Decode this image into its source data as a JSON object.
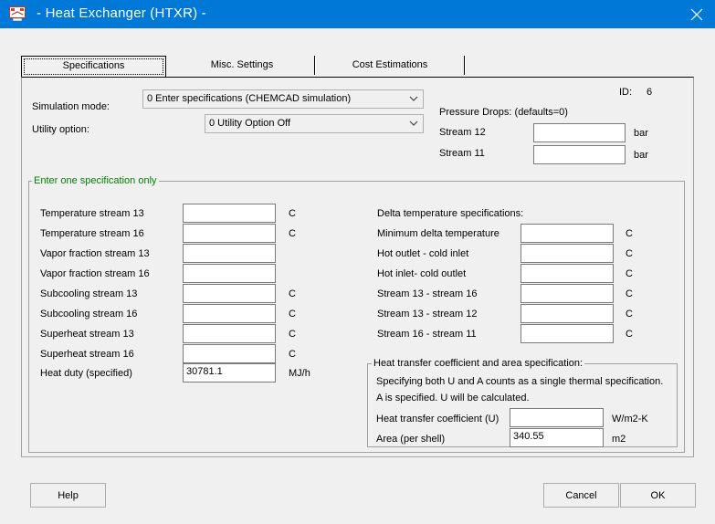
{
  "window": {
    "title": "- Heat Exchanger (HTXR) -"
  },
  "tabs": [
    {
      "label": "Specifications"
    },
    {
      "label": "Misc. Settings"
    },
    {
      "label": "Cost Estimations"
    }
  ],
  "header": {
    "simulation_mode_label": "Simulation mode:",
    "simulation_mode_value": "0 Enter specifications (CHEMCAD simulation)",
    "utility_option_label": "Utility option:",
    "utility_option_value": "0 Utility Option Off",
    "id_label": "ID:",
    "id_value": "6"
  },
  "pressure_drops": {
    "title": "Pressure Drops:  (defaults=0)",
    "rows": [
      {
        "label": "Stream  12",
        "value": "",
        "unit": "bar"
      },
      {
        "label": "Stream  11",
        "value": "",
        "unit": "bar"
      }
    ]
  },
  "spec_group": {
    "title": "Enter one specification only",
    "left_rows": [
      {
        "label": "Temperature stream    13",
        "value": "",
        "unit": "C"
      },
      {
        "label": "Temperature stream  16",
        "value": "",
        "unit": "C"
      },
      {
        "label": "Vapor fraction stream  13",
        "value": "",
        "unit": ""
      },
      {
        "label": "Vapor fraction stream  16",
        "value": "",
        "unit": ""
      },
      {
        "label": "Subcooling stream  13",
        "value": "",
        "unit": "C"
      },
      {
        "label": "Subcooling stream  16",
        "value": "",
        "unit": "C"
      },
      {
        "label": "Superheat stream  13",
        "value": "",
        "unit": "C"
      },
      {
        "label": "Superheat stream  16",
        "value": "",
        "unit": "C"
      },
      {
        "label": "Heat duty (specified)",
        "value": "30781.1",
        "unit": "MJ/h"
      }
    ],
    "delta_title": "Delta temperature specifications:",
    "delta_rows": [
      {
        "label": "Minimum delta temperature",
        "value": "",
        "unit": "C"
      },
      {
        "label": "Hot outlet - cold inlet",
        "value": "",
        "unit": "C"
      },
      {
        "label": "Hot inlet- cold outlet",
        "value": "",
        "unit": "C"
      },
      {
        "label": "Stream 13 - stream 16",
        "value": "",
        "unit": "C"
      },
      {
        "label": "Stream 13 - stream 12",
        "value": "",
        "unit": "C"
      },
      {
        "label": "Stream 16 - stream 11",
        "value": "",
        "unit": "C"
      }
    ]
  },
  "htc_group": {
    "title": "Heat transfer coefficient and area specification:",
    "note1": "Specifying both U and A counts as a single thermal specification.",
    "note2": "A is specified. U will be calculated.",
    "rows": [
      {
        "label": "Heat transfer coefficient  (U)",
        "value": "",
        "unit": "W/m2-K"
      },
      {
        "label": "Area (per shell)",
        "value": "340.55",
        "unit": "m2"
      }
    ]
  },
  "buttons": {
    "help": "Help",
    "cancel": "Cancel",
    "ok": "OK"
  }
}
